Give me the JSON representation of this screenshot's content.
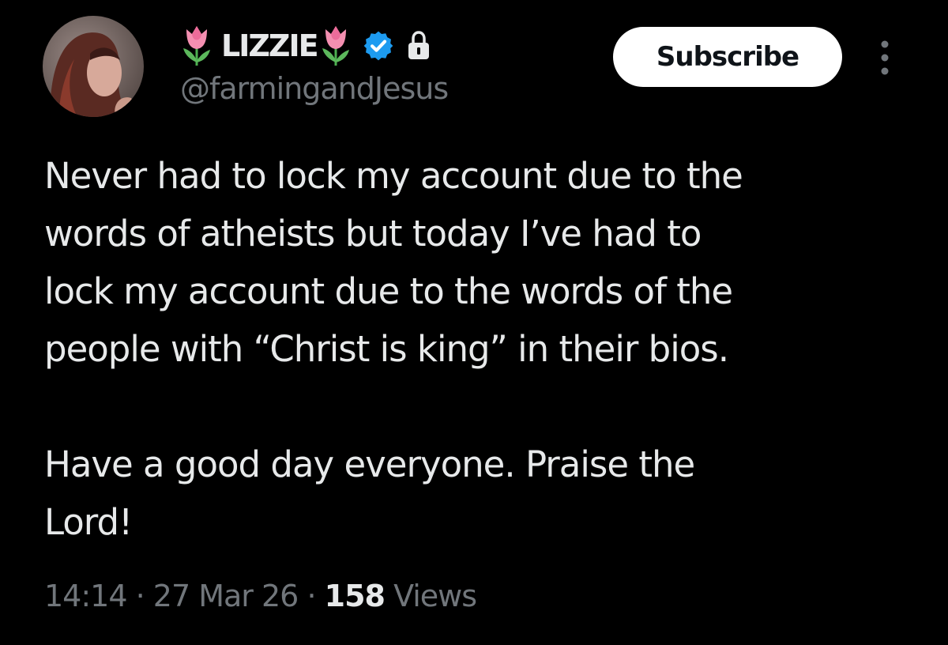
{
  "author": {
    "avatar_icon": "profile-photo",
    "name_prefix_icon": "tulip-emoji",
    "display_name": "LIZZIE",
    "name_suffix_icon": "tulip-emoji",
    "verified_icon": "verified-badge-icon",
    "protected_icon": "lock-icon",
    "handle": "@farmingandJesus"
  },
  "actions": {
    "subscribe_label": "Subscribe",
    "more_icon": "more-options-icon"
  },
  "post": {
    "lines": [
      "Never had to lock my account due to the",
      "words of atheists but today I’ve had to",
      "lock my account due to the words of the",
      "people with “Christ is king” in their bios.",
      "",
      "Have a good day everyone. Praise the",
      "Lord!"
    ]
  },
  "meta": {
    "time": "14:14",
    "separator": "·",
    "date": "27 Mar 26",
    "views_count": "158",
    "views_label": "Views"
  },
  "colors": {
    "background": "#000000",
    "primary_text": "#e7e9ea",
    "secondary_text": "#71767b",
    "verified_blue": "#1d9bf0",
    "button_bg": "#ffffff"
  }
}
